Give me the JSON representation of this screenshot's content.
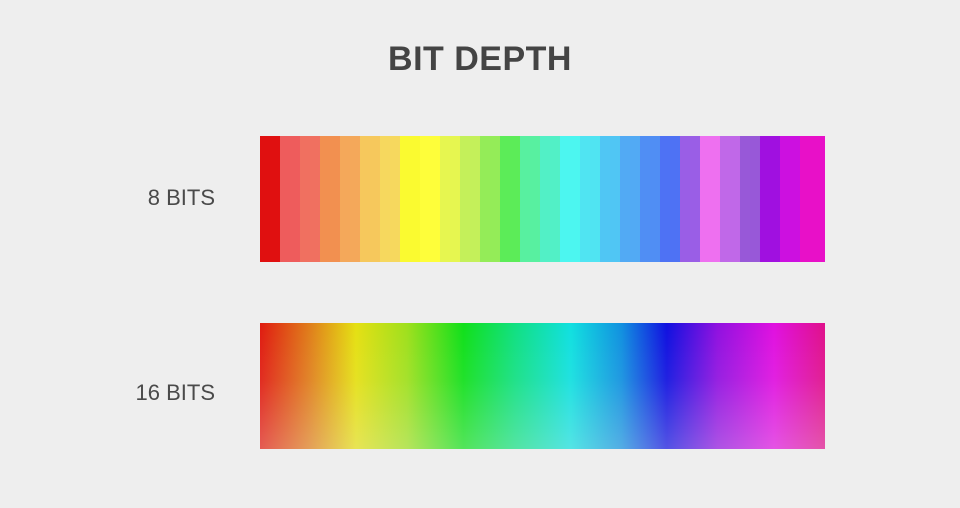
{
  "title": "BIT DEPTH",
  "rows": [
    {
      "label": "8 BITS"
    },
    {
      "label": "16 BITS"
    }
  ],
  "colors": {
    "background": "#eeeeee",
    "text": "#4a4a4a",
    "eight_bit_bands": [
      "#e01010",
      "#ee5c5c",
      "#f07060",
      "#f29050",
      "#f4a85a",
      "#f6c85c",
      "#f6d85e",
      "#fafa30",
      "#fefe3a",
      "#e6f650",
      "#c4f05a",
      "#94ec58",
      "#5cec58",
      "#58f0a0",
      "#52f0c6",
      "#4cf6f0",
      "#50e4f2",
      "#50c6f4",
      "#52aaf4",
      "#508ef4",
      "#4e72f4",
      "#9a5ee6",
      "#ee70f0",
      "#c068e8",
      "#9858d8",
      "#a010e0",
      "#cc10e0",
      "#e810c8"
    ]
  }
}
